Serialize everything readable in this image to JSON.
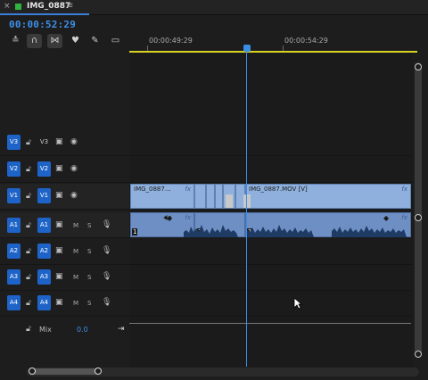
{
  "tab": {
    "close": "×",
    "title": "IMG_0887",
    "menu": "≡",
    "swatch_color": "#2fb43c"
  },
  "timecode": "00:00:52:29",
  "toolbar": [
    {
      "name": "snap-sequence-icon",
      "glyph": "≛"
    },
    {
      "name": "snap-magnet-icon",
      "glyph": "∩"
    },
    {
      "name": "linked-selection-icon",
      "glyph": "⋈"
    },
    {
      "name": "add-marker-icon",
      "glyph": "♥"
    },
    {
      "name": "wrench-settings-icon",
      "glyph": "✎"
    },
    {
      "name": "captions-icon",
      "glyph": "▭"
    }
  ],
  "ruler": {
    "label_left": "00:00:49:29",
    "label_right": "00:00:54:29"
  },
  "tracks": [
    {
      "id": "V3",
      "target": "V3",
      "type": "video"
    },
    {
      "id": "V2",
      "target": "V2",
      "type": "video"
    },
    {
      "id": "V1",
      "target": "V1",
      "type": "video"
    },
    {
      "id": "A1",
      "target": "A1",
      "type": "audio",
      "m": "M",
      "s": "S"
    },
    {
      "id": "A2",
      "target": "A2",
      "type": "audio",
      "m": "M",
      "s": "S"
    },
    {
      "id": "A3",
      "target": "A3",
      "type": "audio",
      "m": "M",
      "s": "S"
    },
    {
      "id": "A4",
      "target": "A4",
      "type": "audio",
      "m": "M",
      "s": "S"
    }
  ],
  "mix": {
    "label": "Mix",
    "value": "0.0"
  },
  "clips": {
    "video_left_label": "IMG_0887...",
    "video_right_label": "IMG_0887.MOV [V]",
    "fx": "fx",
    "audio_num": "1"
  },
  "colors": {
    "accent": "#3e8ee8",
    "track_blue": "#1e64c8",
    "clip_video": "#8fb0dc",
    "clip_audio": "#6e8fc4"
  }
}
